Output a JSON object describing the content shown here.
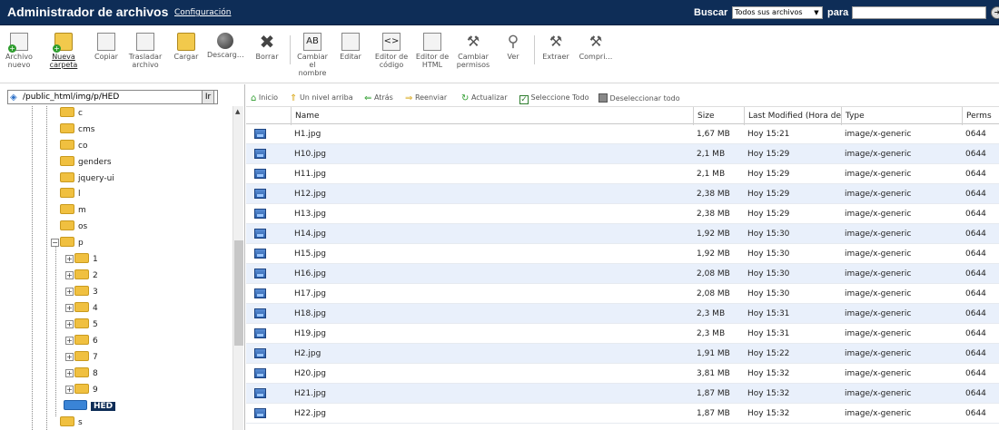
{
  "header": {
    "title": "Administrador de archivos",
    "config_link": "Configuración",
    "search_label": "Buscar",
    "search_scope": "Todos sus archivos",
    "para_label": "para",
    "search_value": ""
  },
  "toolbar": {
    "buttons": [
      {
        "key": "new_file",
        "label": "Archivo nuevo",
        "icon": "new-file-icon"
      },
      {
        "key": "new_folder",
        "label": "Nueva carpeta",
        "icon": "new-folder-icon"
      },
      {
        "key": "copy",
        "label": "Copiar",
        "icon": "copy-icon"
      },
      {
        "key": "move",
        "label": "Trasladar archivo",
        "icon": "move-file-icon"
      },
      {
        "key": "upload",
        "label": "Cargar",
        "icon": "upload-icon"
      },
      {
        "key": "download",
        "label": "Descarg…",
        "icon": "download-icon"
      },
      {
        "key": "delete",
        "label": "Borrar",
        "icon": "delete-icon"
      },
      {
        "key": "rename",
        "label": "Cambiar el nombre",
        "icon": "rename-icon"
      },
      {
        "key": "edit",
        "label": "Editar",
        "icon": "edit-icon"
      },
      {
        "key": "code_editor",
        "label": "Editor de código",
        "icon": "code-editor-icon"
      },
      {
        "key": "html_editor",
        "label": "Editor de HTML",
        "icon": "html-editor-icon"
      },
      {
        "key": "permissions",
        "label": "Cambiar permisos",
        "icon": "permissions-icon"
      },
      {
        "key": "view",
        "label": "Ver",
        "icon": "view-icon"
      },
      {
        "key": "extract",
        "label": "Extraer",
        "icon": "extract-icon"
      },
      {
        "key": "compress",
        "label": "Compri…",
        "icon": "compress-icon"
      }
    ]
  },
  "tree": {
    "path": "/public_html/img/p/HED",
    "go_label": "Ir",
    "nodes": [
      {
        "label": "c"
      },
      {
        "label": "cms"
      },
      {
        "label": "co"
      },
      {
        "label": "genders"
      },
      {
        "label": "jquery-ui"
      },
      {
        "label": "l"
      },
      {
        "label": "m"
      },
      {
        "label": "os"
      },
      {
        "label": "p"
      },
      {
        "label": "1"
      },
      {
        "label": "2"
      },
      {
        "label": "3"
      },
      {
        "label": "4"
      },
      {
        "label": "5"
      },
      {
        "label": "6"
      },
      {
        "label": "7"
      },
      {
        "label": "8"
      },
      {
        "label": "9"
      },
      {
        "label": "HED"
      },
      {
        "label": "s"
      }
    ]
  },
  "nav": {
    "home": "Inicio",
    "up": "Un nivel arriba",
    "back": "Atrás",
    "forward": "Reenviar",
    "refresh": "Actualizar",
    "select_all": "Seleccione Todo",
    "deselect_all": "Deseleccionar todo"
  },
  "grid": {
    "columns": {
      "name": "Name",
      "size": "Size",
      "modified": "Last Modified (Hora de v",
      "type": "Type",
      "perms": "Perms"
    },
    "rows": [
      {
        "name": "H1.jpg",
        "size": "1,67 MB",
        "modified": "Hoy 15:21",
        "type": "image/x-generic",
        "perms": "0644"
      },
      {
        "name": "H10.jpg",
        "size": "2,1 MB",
        "modified": "Hoy 15:29",
        "type": "image/x-generic",
        "perms": "0644"
      },
      {
        "name": "H11.jpg",
        "size": "2,1 MB",
        "modified": "Hoy 15:29",
        "type": "image/x-generic",
        "perms": "0644"
      },
      {
        "name": "H12.jpg",
        "size": "2,38 MB",
        "modified": "Hoy 15:29",
        "type": "image/x-generic",
        "perms": "0644"
      },
      {
        "name": "H13.jpg",
        "size": "2,38 MB",
        "modified": "Hoy 15:29",
        "type": "image/x-generic",
        "perms": "0644"
      },
      {
        "name": "H14.jpg",
        "size": "1,92 MB",
        "modified": "Hoy 15:30",
        "type": "image/x-generic",
        "perms": "0644"
      },
      {
        "name": "H15.jpg",
        "size": "1,92 MB",
        "modified": "Hoy 15:30",
        "type": "image/x-generic",
        "perms": "0644"
      },
      {
        "name": "H16.jpg",
        "size": "2,08 MB",
        "modified": "Hoy 15:30",
        "type": "image/x-generic",
        "perms": "0644"
      },
      {
        "name": "H17.jpg",
        "size": "2,08 MB",
        "modified": "Hoy 15:30",
        "type": "image/x-generic",
        "perms": "0644"
      },
      {
        "name": "H18.jpg",
        "size": "2,3 MB",
        "modified": "Hoy 15:31",
        "type": "image/x-generic",
        "perms": "0644"
      },
      {
        "name": "H19.jpg",
        "size": "2,3 MB",
        "modified": "Hoy 15:31",
        "type": "image/x-generic",
        "perms": "0644"
      },
      {
        "name": "H2.jpg",
        "size": "1,91 MB",
        "modified": "Hoy 15:22",
        "type": "image/x-generic",
        "perms": "0644"
      },
      {
        "name": "H20.jpg",
        "size": "3,81 MB",
        "modified": "Hoy 15:32",
        "type": "image/x-generic",
        "perms": "0644"
      },
      {
        "name": "H21.jpg",
        "size": "1,87 MB",
        "modified": "Hoy 15:32",
        "type": "image/x-generic",
        "perms": "0644"
      },
      {
        "name": "H22.jpg",
        "size": "1,87 MB",
        "modified": "Hoy 15:32",
        "type": "image/x-generic",
        "perms": "0644"
      }
    ]
  }
}
